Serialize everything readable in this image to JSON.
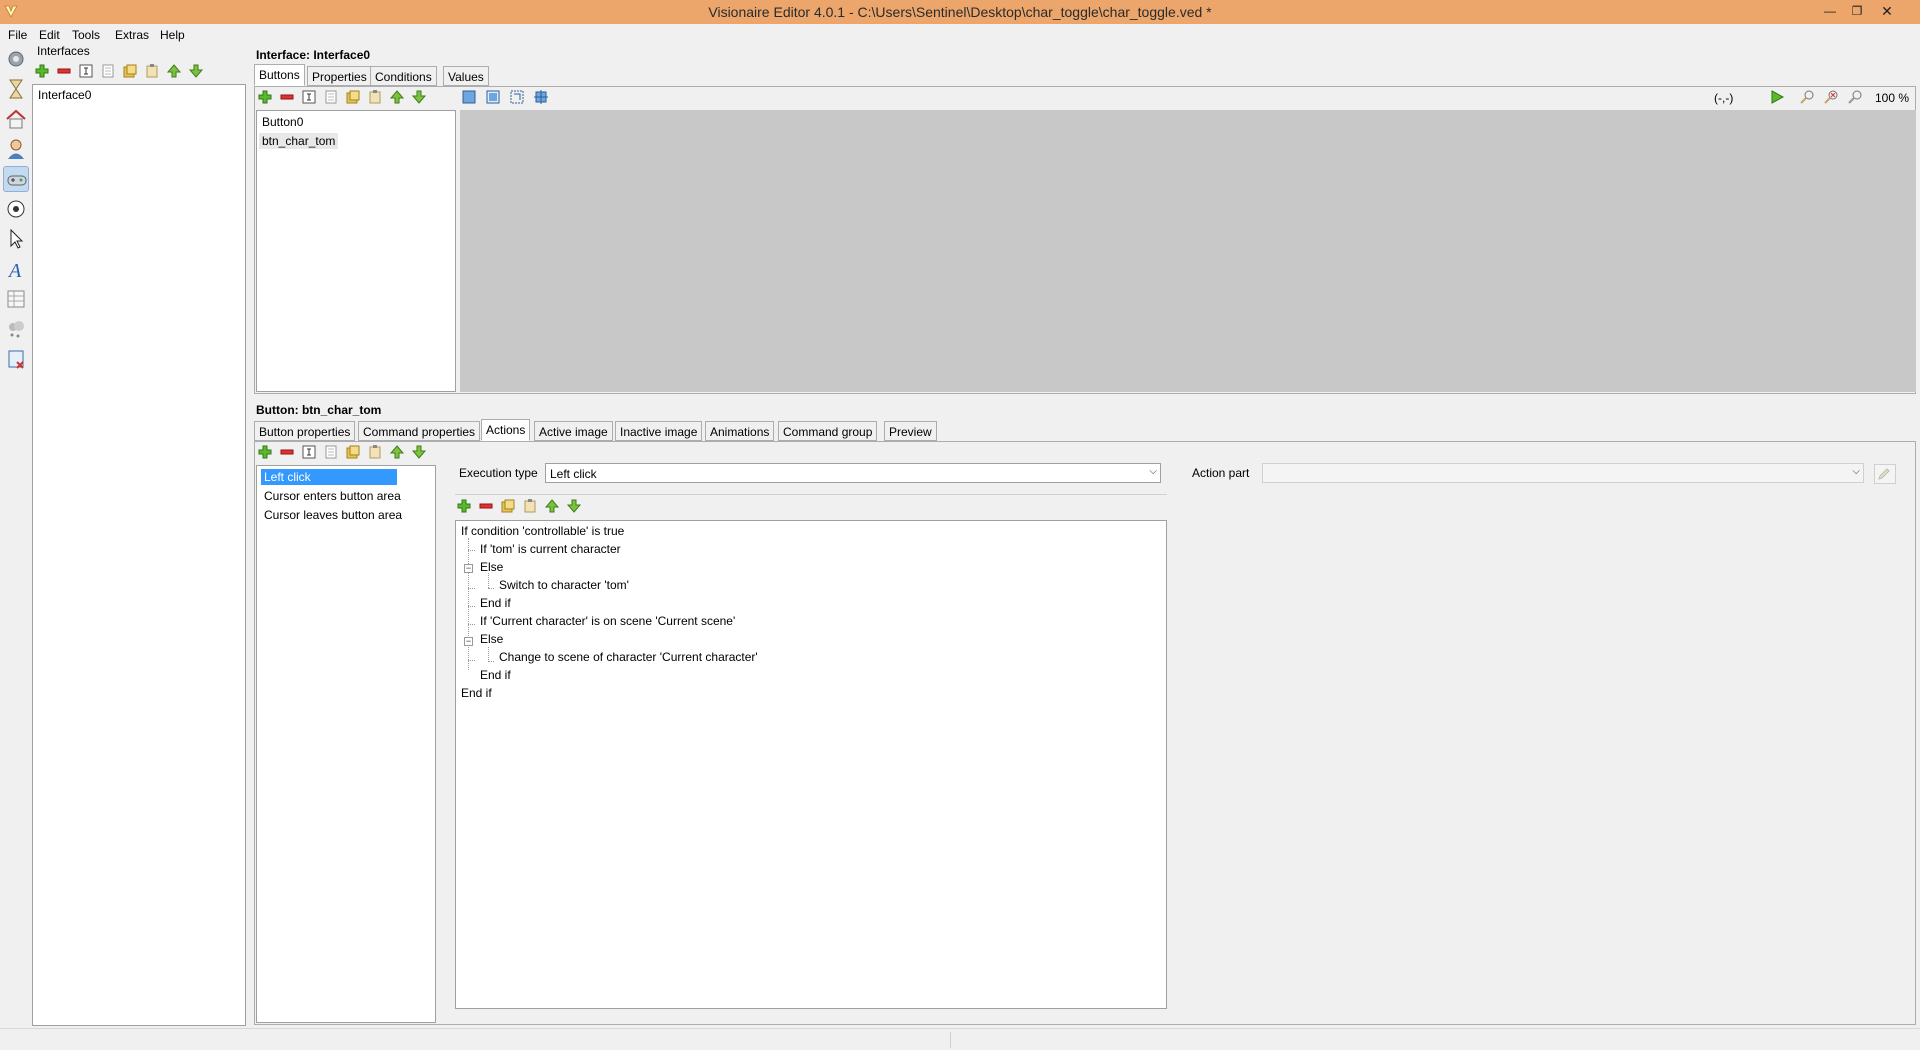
{
  "window": {
    "title": "Visionaire Editor 4.0.1 - C:\\Users\\Sentinel\\Desktop\\char_toggle\\char_toggle.ved *",
    "controls": [
      "minimize-icon",
      "restore-icon",
      "close-icon"
    ]
  },
  "menu": {
    "items": [
      "File",
      "Edit",
      "Tools",
      "Extras",
      "Help"
    ]
  },
  "sidebar": {
    "icons": [
      "settings-icon",
      "hourglass-icon",
      "scene-house-icon",
      "character-icon",
      "gamepad-interface-icon",
      "ball-object-icon",
      "cursor-icon",
      "font-icon",
      "text-table-icon",
      "particles-icon",
      "script-icon"
    ],
    "active": "gamepad-interface-icon"
  },
  "interfaces_panel": {
    "title": "Interfaces",
    "items": [
      "Interface0"
    ]
  },
  "interface_panel": {
    "title": "Interface: Interface0",
    "tabs": [
      "Buttons",
      "Properties",
      "Conditions",
      "Values"
    ],
    "active_tab": "Buttons",
    "buttons_list": [
      "Button0",
      "btn_char_tom"
    ],
    "coords": "(-,-)",
    "zoom": "100 %"
  },
  "button_panel": {
    "title": "Button: btn_char_tom",
    "tabs": [
      "Button properties",
      "Command properties",
      "Actions",
      "Active image",
      "Inactive image",
      "Animations",
      "Command group",
      "Preview"
    ],
    "active_tab": "Actions",
    "action_types": [
      "Left click",
      "Cursor enters button area",
      "Cursor leaves button area"
    ],
    "selected_action_type": "Left click",
    "execution_type_label": "Execution type",
    "execution_type_value": "Left click",
    "action_part_label": "Action part",
    "action_part_value": "",
    "action_lines": [
      "If condition 'controllable' is true",
      "If 'tom' is current character",
      "Else",
      "Switch to character 'tom'",
      "End if",
      "If 'Current character' is on scene 'Current scene'",
      "Else",
      "Change to scene of character 'Current character'",
      "End if",
      "End if"
    ]
  },
  "colors": {
    "titlebar": "#eca56a",
    "selection": "#3399ff",
    "canvas": "#c8c8c8"
  }
}
